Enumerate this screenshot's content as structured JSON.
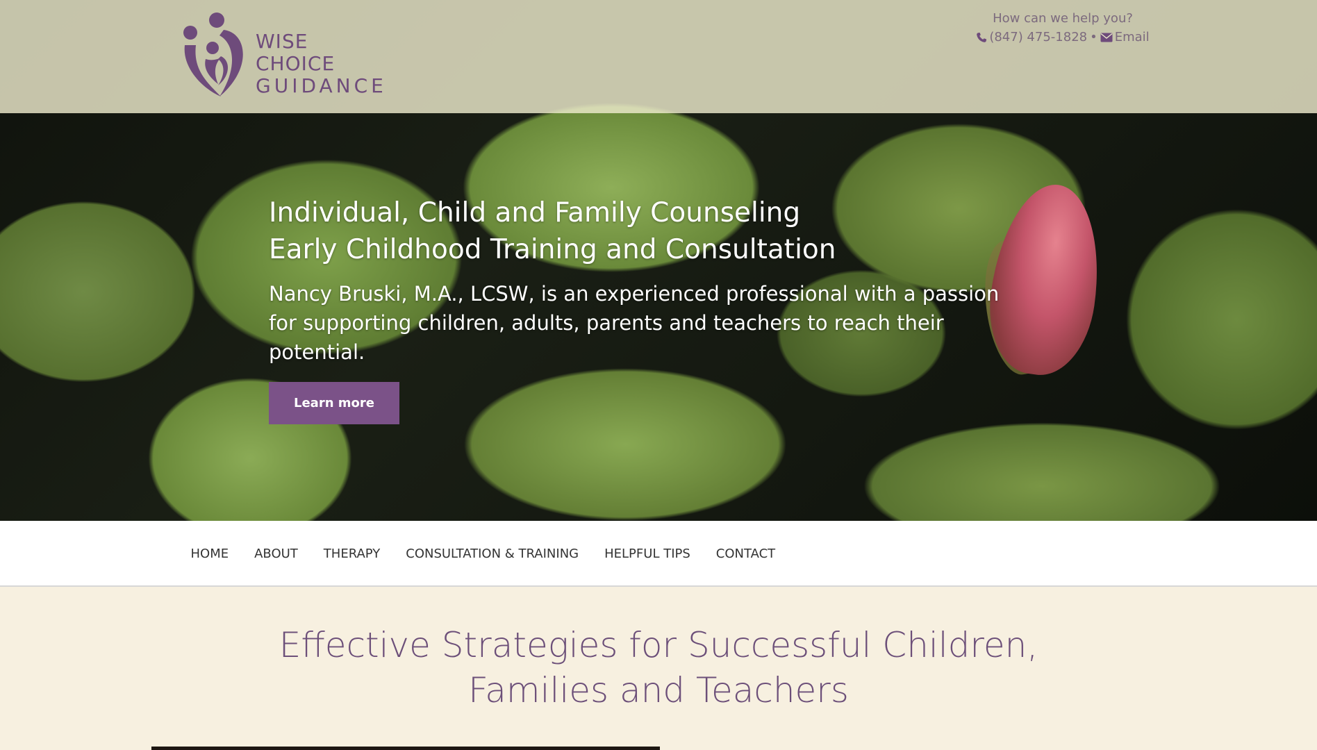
{
  "header": {
    "logo": {
      "line1": "WISE CHOICE",
      "line2": "GUIDANCE"
    },
    "help_prompt": "How can we help you?",
    "phone": "(847) 475-1828",
    "separator": "•",
    "email_label": "Email",
    "icons": {
      "phone": "phone-icon",
      "email": "envelope-icon"
    }
  },
  "hero": {
    "title_line1": "Individual, Child and Family Counseling",
    "title_line2": "Early Childhood Training and Consultation",
    "subtitle": "Nancy Bruski, M.A., LCSW, is an experienced professional with a passion for supporting children, adults, parents and teachers to reach their potential.",
    "cta_label": "Learn more"
  },
  "nav": {
    "items": [
      "HOME",
      "ABOUT",
      "THERAPY",
      "CONSULTATION & TRAINING",
      "HELPFUL TIPS",
      "CONTACT"
    ]
  },
  "main": {
    "heading_line1": "Effective Strategies for Successful Children,",
    "heading_line2": "Families and Teachers"
  },
  "colors": {
    "brand_purple": "#7b5288",
    "logo_purple": "#6e4b7b",
    "heading_purple": "#6c4f79",
    "cream_background": "#f7f0e0",
    "header_overlay": "#eeeccd"
  }
}
